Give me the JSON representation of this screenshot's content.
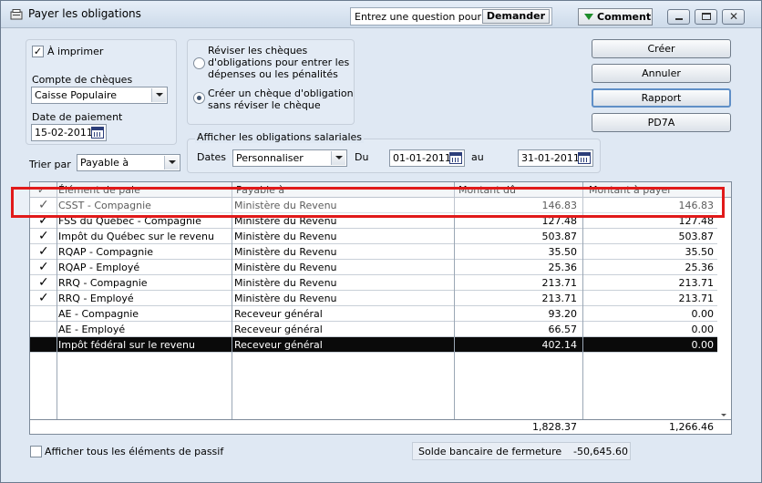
{
  "window": {
    "title": "Payer les obligations",
    "help_label": "Entrez une question pour l'aide",
    "help_button": "Demander",
    "comment_button": "Comment"
  },
  "left": {
    "to_print_label": "À imprimer",
    "to_print_checked": true,
    "account_label": "Compte de chèques",
    "account_value": "Caisse Populaire",
    "payment_date_label": "Date de paiement",
    "payment_date_value": "15-02-2011"
  },
  "options": {
    "radio1_line1": "Réviser les chèques",
    "radio1_line2": "d'obligations pour entrer les",
    "radio1_line3": "dépenses ou les pénalités",
    "radio2_line1": "Créer un chèque d'obligation",
    "radio2_line2": "sans réviser le chèque",
    "selected": 2
  },
  "filter": {
    "group_label": "Afficher les obligations salariales",
    "dates_label": "Dates",
    "dates_value": "Personnaliser",
    "from_label": "Du",
    "from_value": "01-01-2011",
    "to_label": "au",
    "to_value": "31-01-2011"
  },
  "sort": {
    "label": "Trier par",
    "value": "Payable à"
  },
  "buttons": {
    "create": "Créer",
    "cancel": "Annuler",
    "report": "Rapport",
    "pd7a": "PD7A"
  },
  "table": {
    "columns": [
      "✓",
      "Élément de paie",
      "Payable à",
      "Montant dû",
      "Montant à payer"
    ],
    "rows": [
      {
        "checked": true,
        "item": "CSST - Compagnie",
        "payee": "Ministère du Revenu",
        "due": "146.83",
        "pay": "146.83",
        "selected": false
      },
      {
        "checked": true,
        "item": "FSS du Québec - Compagnie",
        "payee": "Ministère du Revenu",
        "due": "127.48",
        "pay": "127.48",
        "selected": false
      },
      {
        "checked": true,
        "item": "Impôt du Québec sur le revenu",
        "payee": "Ministère du Revenu",
        "due": "503.87",
        "pay": "503.87",
        "selected": false
      },
      {
        "checked": true,
        "item": "RQAP - Compagnie",
        "payee": "Ministère du Revenu",
        "due": "35.50",
        "pay": "35.50",
        "selected": false
      },
      {
        "checked": true,
        "item": "RQAP - Employé",
        "payee": "Ministère du Revenu",
        "due": "25.36",
        "pay": "25.36",
        "selected": false
      },
      {
        "checked": true,
        "item": "RRQ - Compagnie",
        "payee": "Ministère du Revenu",
        "due": "213.71",
        "pay": "213.71",
        "selected": false
      },
      {
        "checked": true,
        "item": "RRQ - Employé",
        "payee": "Ministère du Revenu",
        "due": "213.71",
        "pay": "213.71",
        "selected": false
      },
      {
        "checked": false,
        "item": "AE - Compagnie",
        "payee": "Receveur général",
        "due": "93.20",
        "pay": "0.00",
        "selected": false
      },
      {
        "checked": false,
        "item": "AE - Employé",
        "payee": "Receveur général",
        "due": "66.57",
        "pay": "0.00",
        "selected": false
      },
      {
        "checked": false,
        "item": "Impôt fédéral sur le revenu",
        "payee": "Receveur général",
        "due": "402.14",
        "pay": "0.00",
        "selected": true
      }
    ],
    "total_due": "1,828.37",
    "total_pay": "1,266.46"
  },
  "footer": {
    "show_all_label": "Afficher tous les éléments de passif",
    "show_all_checked": false,
    "closing_balance_label": "Solde bancaire de fermeture",
    "closing_balance_value": "-50,645.60"
  },
  "colors": {
    "highlight": "#e11a1a",
    "window_bg": "#dfe8f3",
    "selected_row": "#0a0a0a"
  }
}
